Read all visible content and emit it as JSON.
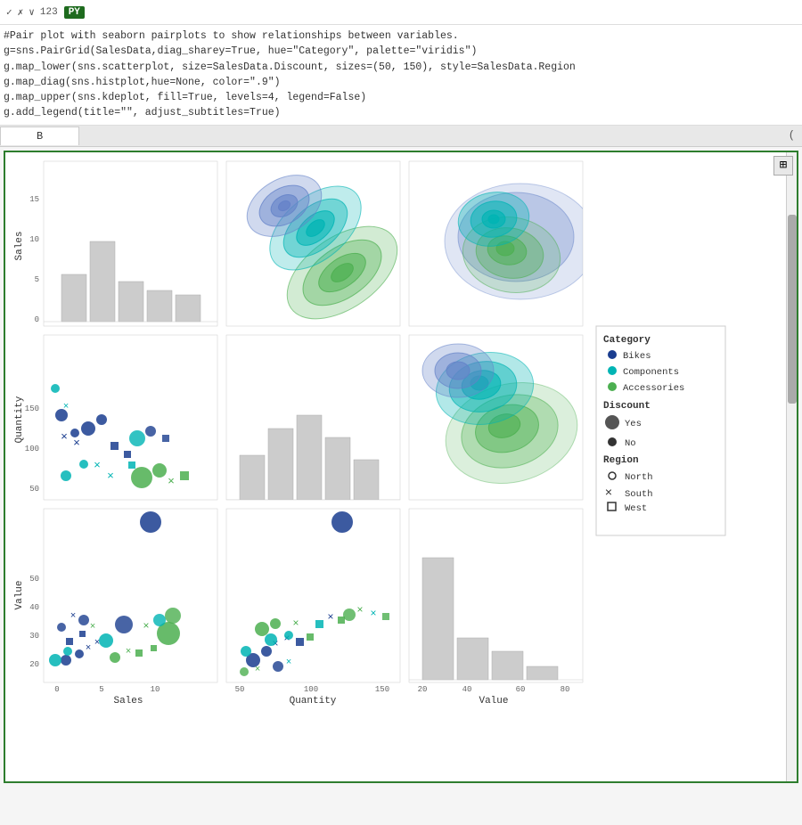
{
  "toolbar": {
    "check_icon": "✓",
    "x_icon": "✗",
    "chevron_icon": "∨",
    "cell_number": "123",
    "py_label": "PY"
  },
  "code": {
    "lines": [
      "#Pair plot with seaborn pairplots to show relationships between variables.",
      "g=sns.PairGrid(SalesData,diag_sharey=True, hue=\"Category\", palette=\"viridis\")",
      "g.map_lower(sns.scatterplot, size=SalesData.Discount, sizes=(50, 150), style=SalesData.Region",
      "g.map_diag(sns.histplot,hue=None, color=\".9\")",
      "g.map_upper(sns.kdeplot, fill=True, levels=4, legend=False)",
      "g.add_legend(title=\"\", adjust_subtitles=True)"
    ]
  },
  "tab": {
    "label": "B",
    "expand_icon": "("
  },
  "legend": {
    "category_title": "Category",
    "items": [
      {
        "label": "Bikes",
        "color": "#1a3d8f",
        "shape": "circle"
      },
      {
        "label": "Components",
        "color": "#00b4b4",
        "shape": "circle"
      },
      {
        "label": "Accessories",
        "color": "#4caf50",
        "shape": "circle"
      }
    ],
    "discount_title": "Discount",
    "discount_items": [
      {
        "label": "Yes",
        "size": "large"
      },
      {
        "label": "No",
        "size": "small"
      }
    ],
    "region_title": "Region",
    "region_items": [
      {
        "label": "North",
        "shape": "circle"
      },
      {
        "label": "South",
        "shape": "x"
      },
      {
        "label": "West",
        "shape": "square"
      }
    ]
  },
  "axes": {
    "row1_ylabel": "Sales",
    "row2_ylabel": "Quantity",
    "row3_ylabel": "Value",
    "col1_xlabel": "Sales",
    "col2_xlabel": "Quantity",
    "col3_xlabel": "Value",
    "sales_yticks": [
      "15",
      "10",
      "5",
      "0"
    ],
    "quantity_yticks": [
      "150",
      "100",
      "50"
    ],
    "value_yticks": [
      "50",
      "40",
      "30",
      "20"
    ],
    "sales_xticks": [
      "0",
      "5",
      "10"
    ],
    "quantity_xticks": [
      "50",
      "100",
      "150"
    ],
    "value_xticks": [
      "20",
      "40",
      "60",
      "80"
    ]
  }
}
